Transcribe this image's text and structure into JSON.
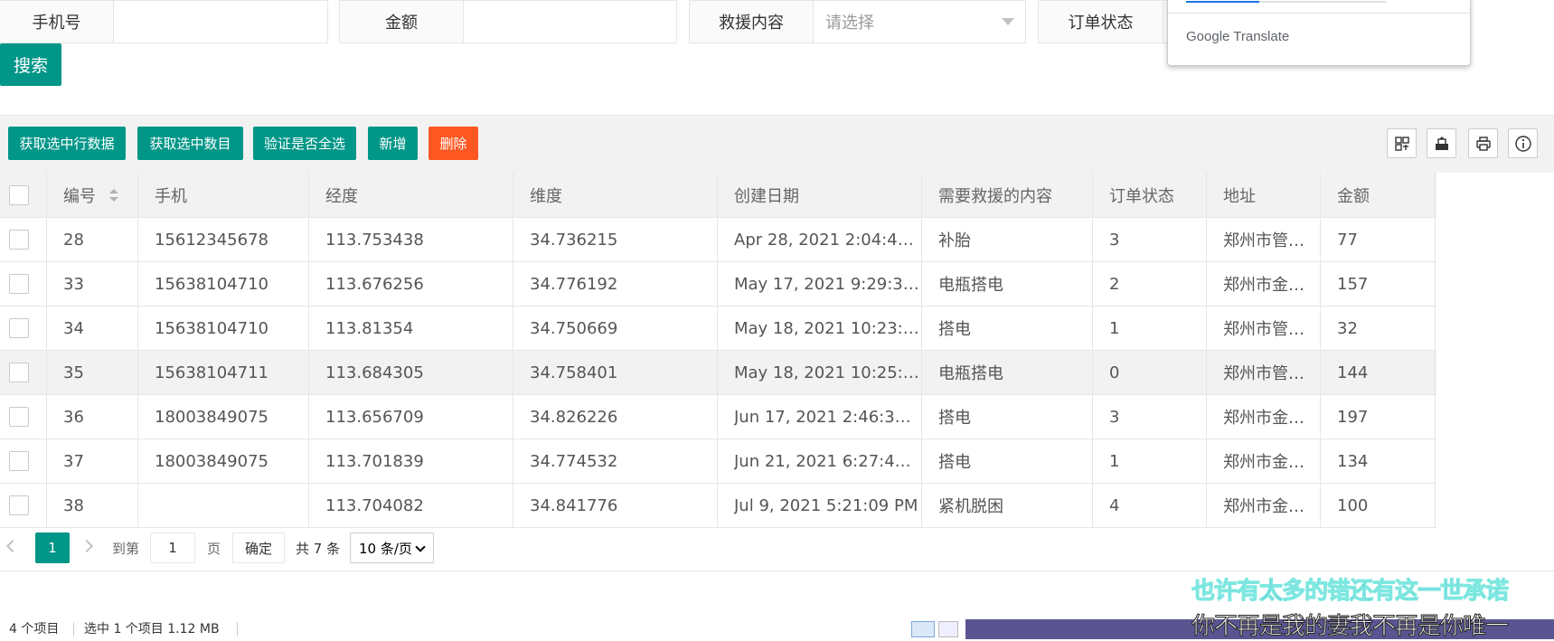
{
  "form": {
    "phone_label": "手机号",
    "amount_label": "金额",
    "rescue_label": "救援内容",
    "rescue_placeholder": "请选择",
    "order_label": "订单状态",
    "search_button": "搜索"
  },
  "google_translate": {
    "brand": "Google Translate"
  },
  "toolbar": {
    "get_rows": "获取选中行数据",
    "get_count": "获取选中数目",
    "verify_all": "验证是否全选",
    "add": "新增",
    "delete": "删除",
    "delete_color": "#ff5722",
    "accent": "#009688",
    "icons": [
      "columns-icon",
      "export-icon",
      "print-icon",
      "info-icon"
    ]
  },
  "table": {
    "headers": [
      "编号",
      "手机",
      "经度",
      "维度",
      "创建日期",
      "需要救援的内容",
      "订单状态",
      "地址",
      "金额"
    ],
    "rows": [
      [
        "28",
        "15612345678",
        "113.753438",
        "34.736215",
        "Apr 28, 2021 2:04:44 …",
        "补胎",
        "3",
        "郑州市管…",
        "77"
      ],
      [
        "33",
        "15638104710",
        "113.676256",
        "34.776192",
        "May 17, 2021 9:29:38…",
        "电瓶搭电",
        "2",
        "郑州市金…",
        "157"
      ],
      [
        "34",
        "15638104710",
        "113.81354",
        "34.750669",
        "May 18, 2021 10:23:4…",
        "搭电",
        "1",
        "郑州市管…",
        "32"
      ],
      [
        "35",
        "15638104711",
        "113.684305",
        "34.758401",
        "May 18, 2021 10:25:1…",
        "电瓶搭电",
        "0",
        "郑州市管…",
        "144"
      ],
      [
        "36",
        "18003849075",
        "113.656709",
        "34.826226",
        "Jun 17, 2021 2:46:37 …",
        "搭电",
        "3",
        "郑州市金…",
        "197"
      ],
      [
        "37",
        "18003849075",
        "113.701839",
        "34.774532",
        "Jun 21, 2021 6:27:45 …",
        "搭电",
        "1",
        "郑州市金…",
        "134"
      ],
      [
        "38",
        "",
        "113.704082",
        "34.841776",
        "Jul 9, 2021 5:21:09 PM",
        "紧机脱困",
        "4",
        "郑州市金…",
        "100"
      ]
    ]
  },
  "pager": {
    "current": "1",
    "goto_label": "到第",
    "goto_value": "1",
    "page_unit": "页",
    "confirm": "确定",
    "total": "共 7 条",
    "page_size": "10 条/页"
  },
  "statusbar": {
    "items": "4 个项目",
    "selected": "选中 1 个项目  1.12 MB"
  },
  "lyrics": {
    "line1": "也许有太多的错还有这一世承诺",
    "line2": "你不再是我的妻我不再是你唯一"
  }
}
